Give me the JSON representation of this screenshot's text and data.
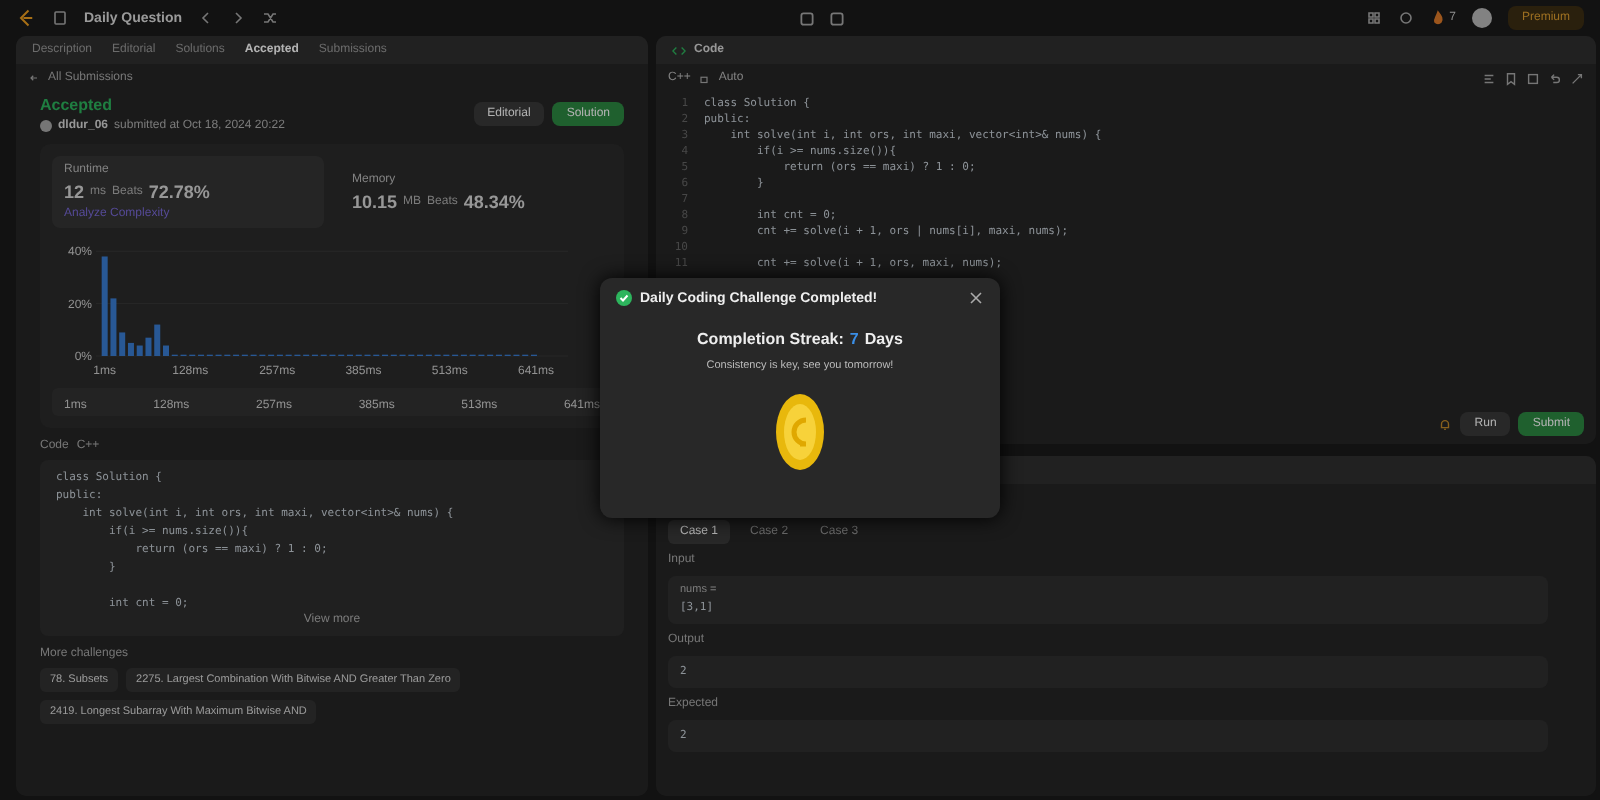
{
  "top_bar": {
    "title": "Daily Question",
    "streak": "7",
    "premium": "Premium"
  },
  "left_panel": {
    "tabs": [
      {
        "label": "Description",
        "selected": false
      },
      {
        "label": "Editorial",
        "selected": false
      },
      {
        "label": "Solutions",
        "selected": false
      },
      {
        "label": "Accepted",
        "selected": true
      },
      {
        "label": "Submissions",
        "selected": false
      }
    ],
    "back_link": "All Submissions",
    "status": "Accepted",
    "user": "dldur_06",
    "submitted": "submitted at Oct 18, 2024 20:22",
    "buttons": [
      "Editorial",
      "Solution"
    ],
    "runtime": {
      "label": "Runtime",
      "value": "12",
      "unit": "ms",
      "beats_label": "Beats",
      "beats": "72.78%",
      "link": "Analyze Complexity"
    },
    "memory": {
      "label": "Memory",
      "value": "10.15",
      "unit": "MB",
      "beats_label": "Beats",
      "beats": "48.34%"
    },
    "chart_data": {
      "type": "bar",
      "x": [
        1,
        14,
        27,
        40,
        53,
        66,
        79,
        92,
        105,
        118,
        131,
        144,
        157,
        170,
        183,
        196,
        209,
        222,
        235,
        248,
        261,
        274,
        287,
        300,
        313,
        326,
        339,
        352,
        365,
        378,
        391,
        404,
        417,
        430,
        443,
        456,
        469,
        482,
        495,
        508,
        521,
        534,
        547,
        560,
        573,
        586,
        599,
        612,
        625,
        638
      ],
      "values": [
        38,
        22,
        9,
        5,
        4,
        7,
        12,
        4,
        0.5,
        0.5,
        0.5,
        0.5,
        0.5,
        0.5,
        0.5,
        0.5,
        0.5,
        0.5,
        0.5,
        0.5,
        0.5,
        0.5,
        0.5,
        0.5,
        0.5,
        0.5,
        0.5,
        0.5,
        0.5,
        0.5,
        0.5,
        0.5,
        0.5,
        0.5,
        0.5,
        0.5,
        0.5,
        0.5,
        0.5,
        0.5,
        0.5,
        0.5,
        0.5,
        0.5,
        0.5,
        0.5,
        0.5,
        0.5,
        0.5,
        0.5
      ],
      "xlim": [
        0,
        641
      ],
      "ylim": [
        0,
        42
      ],
      "yticks": [
        {
          "value": 0,
          "label": "0%"
        },
        {
          "value": 20,
          "label": "20%"
        },
        {
          "value": 40,
          "label": "40%"
        }
      ],
      "xticks": [
        {
          "value": 1,
          "label": "1ms"
        },
        {
          "value": 128,
          "label": "128ms"
        },
        {
          "value": 257,
          "label": "257ms"
        },
        {
          "value": 385,
          "label": "385ms"
        },
        {
          "value": 513,
          "label": "513ms"
        },
        {
          "value": 641,
          "label": "641ms"
        }
      ]
    },
    "brush_ticks": [
      "1ms",
      "128ms",
      "257ms",
      "385ms",
      "513ms",
      "641ms"
    ],
    "code_label": "Code",
    "code_lang": "C++",
    "code_lines": [
      {
        "kind": "code",
        "text": "class Solution {"
      },
      {
        "kind": "code",
        "text": "public:"
      },
      {
        "kind": "code",
        "text": "    int solve(int i, int ors, int maxi, vector<int>& nums) {"
      },
      {
        "kind": "code",
        "text": "        if(i >= nums.size()){"
      },
      {
        "kind": "code",
        "text": "            return (ors == maxi) ? 1 : 0;"
      },
      {
        "kind": "code",
        "text": "        }"
      },
      {
        "kind": "blank"
      },
      {
        "kind": "code",
        "text": "        int cnt = 0;"
      }
    ],
    "view_more": "View more",
    "more_label": "More challenges",
    "challenges": [
      "78. Subsets",
      "2275. Largest Combination With Bitwise AND Greater Than Zero",
      "2419. Longest Subarray With Maximum Bitwise AND"
    ]
  },
  "editor": {
    "title": "Code",
    "language": "C++",
    "mode": "Auto",
    "lines": [
      {
        "n": "1",
        "text": "class Solution {"
      },
      {
        "n": "2",
        "text": "public:"
      },
      {
        "n": "3",
        "text": "    int solve(int i, int ors, int maxi, vector<int>& nums) {"
      },
      {
        "n": "4",
        "text": "        if(i >= nums.size()){"
      },
      {
        "n": "5",
        "text": "            return (ors == maxi) ? 1 : 0;"
      },
      {
        "n": "6",
        "text": "        }"
      },
      {
        "n": "7"
      },
      {
        "n": "8",
        "text": "        int cnt = 0;"
      },
      {
        "n": "9",
        "text": "        cnt += solve(i + 1, ors | nums[i], maxi, nums);"
      },
      {
        "n": "10"
      },
      {
        "n": "11",
        "text": "        cnt += solve(i + 1, ors, maxi, nums);"
      }
    ],
    "run": "Run",
    "submit": "Submit"
  },
  "testcases": {
    "cases": [
      {
        "label": "Case 1",
        "selected": true
      },
      {
        "label": "Case 2",
        "selected": false
      },
      {
        "label": "Case 3",
        "selected": false
      }
    ],
    "input_label": "Input",
    "var_name": "nums =",
    "input": "[3,1]",
    "output_label": "Output",
    "output": "2",
    "expected_label": "Expected",
    "expected": "2"
  },
  "modal": {
    "title": "Daily Coding Challenge Completed!",
    "streak_label": "Completion Streak:",
    "streak": "7",
    "streak_unit": "Days",
    "message": "Consistency is key, see you tomorrow!"
  }
}
